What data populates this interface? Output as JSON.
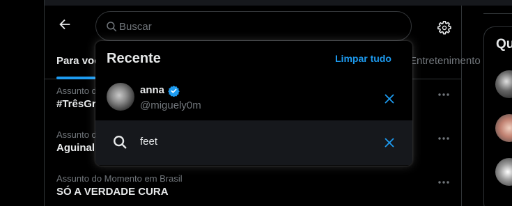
{
  "search": {
    "placeholder": "Buscar",
    "value": ""
  },
  "tabs": [
    {
      "label": "Para você"
    },
    {
      "label": "Entretenimento"
    }
  ],
  "trends": [
    {
      "context": "Assunto do Momento em Brasil",
      "name": "#TrêsGr"
    },
    {
      "context": "Assunto do Momento em Brasil",
      "name": "Aguinal"
    },
    {
      "context": "Assunto do Momento em Brasil",
      "name": "SÓ A VERDADE CURA"
    }
  ],
  "recent": {
    "title": "Recente",
    "clear_label": "Limpar tudo",
    "user": {
      "name": "anna",
      "handle": "@miguely0m",
      "verified": true
    },
    "query": "feet"
  },
  "right_panel": {
    "title": "Qu"
  },
  "colors": {
    "accent": "#1d9bf0",
    "background": "#000000",
    "muted_text": "#71767b",
    "border": "#2f3336",
    "hover_row": "#16181c"
  },
  "icons": [
    "back-arrow-icon",
    "search-icon",
    "gear-icon",
    "verified-badge-icon",
    "close-icon",
    "more-icon"
  ]
}
